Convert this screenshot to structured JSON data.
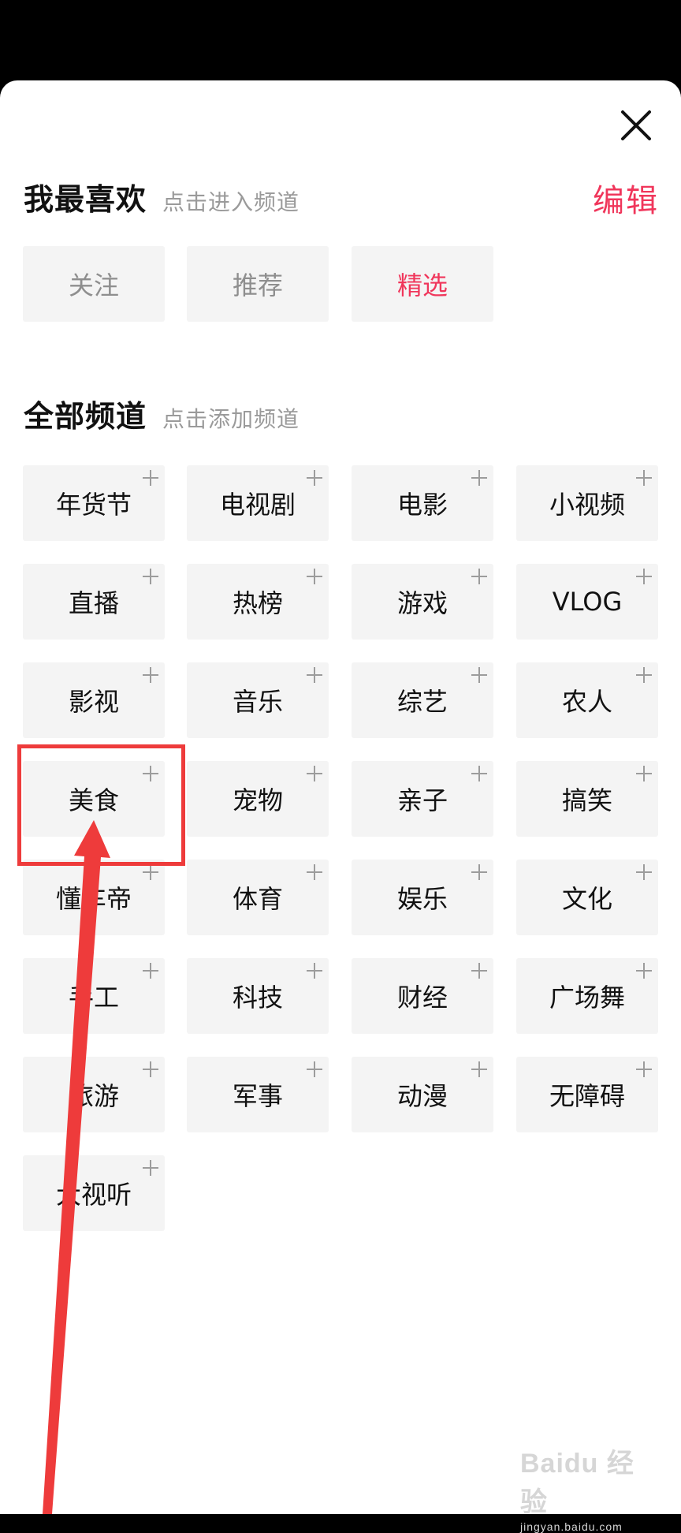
{
  "favorites": {
    "title": "我最喜欢",
    "hint": "点击进入频道",
    "edit_label": "编辑",
    "channels": [
      {
        "label": "关注",
        "state": "muted"
      },
      {
        "label": "推荐",
        "state": "muted"
      },
      {
        "label": "精选",
        "state": "active"
      }
    ]
  },
  "all_channels": {
    "title": "全部频道",
    "hint": "点击添加频道",
    "channels": [
      "年货节",
      "电视剧",
      "电影",
      "小视频",
      "直播",
      "热榜",
      "游戏",
      "VLOG",
      "影视",
      "音乐",
      "综艺",
      "农人",
      "美食",
      "宠物",
      "亲子",
      "搞笑",
      "懂车帝",
      "体育",
      "娱乐",
      "文化",
      "手工",
      "科技",
      "财经",
      "广场舞",
      "旅游",
      "军事",
      "动漫",
      "无障碍",
      "大视听"
    ]
  },
  "annotation": {
    "highlighted_channel": "美食",
    "color": "#ee3b3b"
  },
  "watermark": {
    "main": "Baidu 经验",
    "sub": "jingyan.baidu.com"
  },
  "colors": {
    "accent": "#f0365b",
    "tile_bg": "#f4f4f4",
    "hint": "#9a9a9a"
  },
  "icons": {
    "close": "close-icon",
    "add": "plus-icon"
  }
}
